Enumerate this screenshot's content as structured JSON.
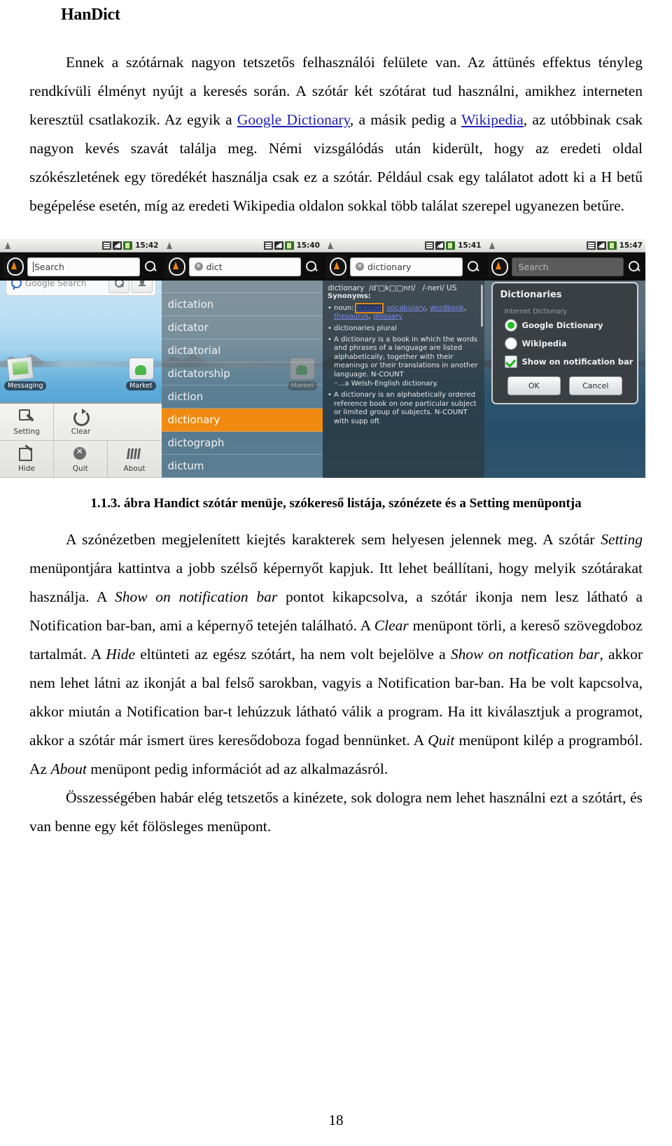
{
  "document": {
    "title": "HanDict",
    "page_number": "18"
  },
  "paragraphs": {
    "intro": {
      "part1": "Ennek a szótárnak nagyon tetszetős felhasználói felülete van. Az áttünés effektus tényleg rendkívüli élményt nyújt a keresés során. A szótár két szótárat tud használni, amikhez interneten keresztül csatlakozik. Az egyik a ",
      "link1": "Google Dictionary",
      "part2": ", a másik pedig a ",
      "link2": "Wikipedia",
      "part3": ", az utóbbinak csak nagyon kevés szavát találja meg. Némi vizsgálódás után kiderült, hogy az eredeti oldal szókészletének  egy töredékét használja csak ez a szótár. Például csak egy találatot adott ki a H betű begépelése esetén, míg az eredeti Wikipedia oldalon sokkal több találat szerepel ugyanezen betűre."
    },
    "after_figure": {
      "s1": "A szónézetben megjelenített kiejtés karakterek sem helyesen jelennek meg. A szótár ",
      "i1": "Setting",
      "s2": " menüpontjára kattintva a jobb szélső képernyőt kapjuk. Itt lehet beállítani, hogy melyik szótárakat használja. A ",
      "i2": "Show on notification bar",
      "s3": " pontot kikapcsolva, a szótár  ikonja nem lesz látható a Notification bar-ban, ami a képernyő tetején található. A ",
      "i3": "Clear",
      "s4": " menüpont törli, a kereső szövegdoboz tartalmát. A ",
      "i4": "Hide",
      "s5": " eltünteti az egész szótárt, ha nem volt bejelölve a ",
      "i5": "Show on notfication bar",
      "s6": ", akkor nem lehet látni az ikonját a bal felső sarokban, vagyis a  Notification bar-ban. Ha be volt kapcsolva, akkor miután a Notification bar-t lehúzzuk látható válik a program. Ha itt kiválasztjuk a programot, akkor a szótár már ismert üres keresődoboza fogad bennünket. A ",
      "i6": "Quit",
      "s7": " menüpont kilép a programból. Az ",
      "i7": "About",
      "s8": " menüpont pedig információt ad az alkalmazásról."
    },
    "closing": "Összességében habár elég tetszetős a kinézete, sok dologra nem lehet használni ezt a szótárt, és van benne egy két fölösleges menüpont."
  },
  "figure": {
    "caption": "1.1.3. ábra Handict szótár menüje, szókereső listája, szónézete és a Setting menüpontja",
    "accent_color": "#f08a10",
    "screenshots": [
      {
        "name": "home-menu",
        "status_time": "15:42",
        "search_placeholder": "Search",
        "widget_text": "Google Search",
        "home_icons": [
          "Messaging",
          "Market"
        ],
        "menu_items": [
          "Setting",
          "Clear",
          "Hide",
          "Quit",
          "About"
        ]
      },
      {
        "name": "suggestion-list",
        "status_time": "15:40",
        "search_value": "dict",
        "suggestions": [
          "dictation",
          "dictator",
          "dictatorial",
          "dictatorship",
          "diction",
          "dictionary",
          "dictograph",
          "dictum"
        ],
        "selected_suggestion": "dictionary"
      },
      {
        "name": "word-view",
        "status_time": "15:41",
        "search_value": "dictionary",
        "headword": "dictionary",
        "pronunciation_uk": "/d'□k□□nri/",
        "pronunciation_us": "/-neri/ US",
        "synonyms_label": "Synonyms:",
        "pos": "noun:",
        "synonyms": [
          "lexicon",
          "vocabulary",
          "wordbook",
          "thesaurus",
          "glossary"
        ],
        "selected_synonym": "lexicon",
        "plural_note": "dictionaries plural",
        "sense1": "A dictionary is a book in which the words and phrases of a language are listed alphabetically, together with their meanings or their translations in another language. N-COUNT",
        "example1": "...a Welsh-English dictionary.",
        "sense2": "A dictionary is an alphabetically ordered reference book on one particular subject or limited group of subjects. N-COUNT with supp oft"
      },
      {
        "name": "settings-dialog",
        "status_time": "15:47",
        "search_placeholder": "Search",
        "dialog_title": "Dictionaries",
        "section_label": "Internet Dictionary",
        "options": [
          {
            "label": "Google Dictionary",
            "type": "radio",
            "selected": true
          },
          {
            "label": "Wikipedia",
            "type": "radio",
            "selected": false
          },
          {
            "label": "Show on notification bar",
            "type": "checkbox",
            "selected": true
          }
        ],
        "buttons": [
          "OK",
          "Cancel"
        ]
      }
    ]
  }
}
